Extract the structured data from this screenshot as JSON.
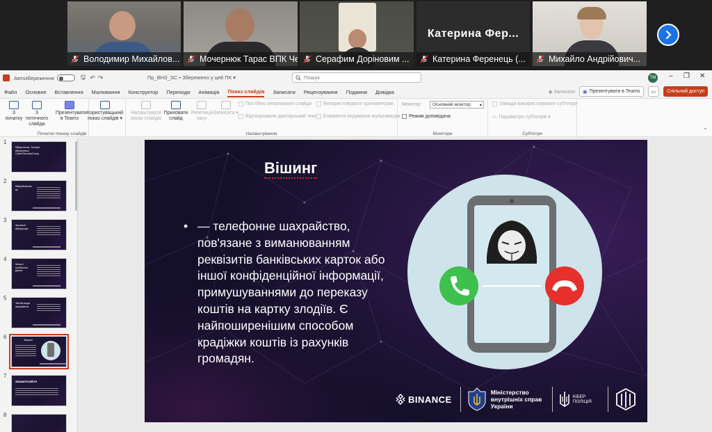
{
  "meeting": {
    "participants": [
      {
        "name": "Володимир Михайлов..."
      },
      {
        "name": "Мочернюк Тарас ВПК Че..."
      },
      {
        "name": "Серафим Доріновим ..."
      },
      {
        "name": "Катерина  Ференець (..."
      },
      {
        "name": "Михайло Андрійович..."
      }
    ],
    "featured_label": "Катерина  Фер..."
  },
  "ppt": {
    "autosave_label": "Автозбереження",
    "doc_title": "Пр_ВНЗ_SC  •  Збережено у цей ПК ▾",
    "search_placeholder": "Пошук",
    "avatar_initials": "TM",
    "menu": [
      "Файл",
      "Основне",
      "Вставлення",
      "Малювання",
      "Конструктор",
      "Переходи",
      "Анімація",
      "Показ слайдів",
      "Записати",
      "Рецензування",
      "Подання",
      "Довідка"
    ],
    "active_menu": "Показ слайдів",
    "record_label": "Записати",
    "present_teams_label": "Презентувати в Teams",
    "share_label": "Спільний доступ",
    "ribbon": {
      "from_start": "З початку",
      "from_current": "З поточного слайда",
      "present_teams": "Презентувати в Teams",
      "custom_show": "Користувацький показ слайдів ▾",
      "group_start": "Початок показу слайдів",
      "setup_show": "Налаштувати показ слайдів",
      "hide_slide": "Приховати слайд",
      "rehearse": "Репетиція часу",
      "record": "Записати ▾",
      "check_play_narrations": "Постійно оновлювати слайди",
      "check_use_timings": "Використовувати хронометраж",
      "check_record_show": "Відтворювати дикторський текст",
      "check_media_controls": "Елементи керування мультимедіа",
      "group_setup": "Налаштування",
      "monitor_label": "Монітор:",
      "monitor_value": "Основний монітор",
      "presenter_view": "Режим доповідача",
      "group_monitors": "Монітори",
      "always_subtitles": "Завжди використовувати субтитри",
      "subtitle_settings": "Параметри субтитрів ▾",
      "group_subtitles": "Субтитри"
    },
    "thumbnails": [
      {
        "num": "1",
        "title": "Кібергігієна. Основи кібергігієни. CyberSecurityCamp"
      },
      {
        "num": "2",
        "title": "Кібербезпека: як"
      },
      {
        "num": "3",
        "title": "Загальні кібератаки"
      },
      {
        "num": "4",
        "title": "Захист особистих даних"
      },
      {
        "num": "5",
        "title": "Типові види шахрайств"
      },
      {
        "num": "6",
        "title": "Вішинг"
      },
      {
        "num": "7",
        "title": "Запам'ятайте!"
      },
      {
        "num": "8",
        "title": ""
      }
    ],
    "selected_thumbnail": "6",
    "slide": {
      "title": "Вішинг",
      "bullet": "— телефонне шахрайство, пов'язане з виманюванням реквізитів банківських карток або іншої конфіденційної інформації, примушуваннями до переказу коштів на картку злодіїв. Є найпоширенішим способом крадіжки коштів із рахунків громадян.",
      "logos": {
        "binance": "BINANCE",
        "ministry": "Міністерство внутрішніх справ України",
        "cyber": "КІБЕР ПОЛІЦІЯ"
      }
    }
  },
  "colors": {
    "teams_bg": "#1f1f1f",
    "ppt_accent": "#c43e1c",
    "slide_bg": "#14102a",
    "accept_green": "#3ec04f",
    "decline_red": "#e5302c",
    "phone_circle": "#cfe3ea"
  }
}
